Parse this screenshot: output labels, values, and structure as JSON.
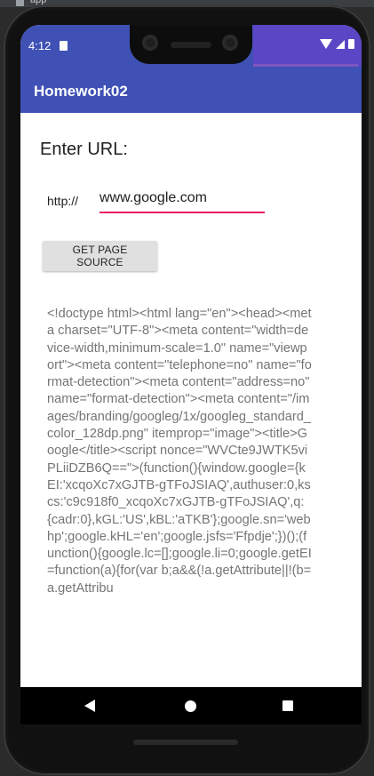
{
  "ide": {
    "tab_label": "app"
  },
  "statusbar": {
    "time": "4:12"
  },
  "appbar": {
    "title": "Homework02"
  },
  "form": {
    "heading": "Enter URL:",
    "prefix": "http://",
    "url_value": "www.google.com",
    "button_label": "GET PAGE SOURCE"
  },
  "output": {
    "source_text": "<!doctype html><html lang=\"en\"><head><meta charset=\"UTF-8\"><meta content=\"width=device-width,minimum-scale=1.0\" name=\"viewport\"><meta content=\"telephone=no\" name=\"format-detection\"><meta content=\"address=no\" name=\"format-detection\"><meta content=\"/images/branding/googleg/1x/googleg_standard_color_128dp.png\" itemprop=\"image\"><title>Google</title><script nonce=\"WVCte9JWTK5viPLiiDZB6Q==\">(function(){window.google={kEI:'xcqoXc7xGJTB-gTFoJSIAQ',authuser:0,kscs:'c9c918f0_xcqoXc7xGJTB-gTFoJSIAQ',q:{cadr:0},kGL:'US',kBL:'aTKB'};google.sn='webhp';google.kHL='en';google.jsfs='Ffpdje';})();(function(){google.lc=[];google.li=0;google.getEI=function(a){for(var b;a&&(!a.getAttribute||!(b=a.getAttribu"
  },
  "colors": {
    "primary": "#3f51b5",
    "accent": "#e91e63"
  }
}
